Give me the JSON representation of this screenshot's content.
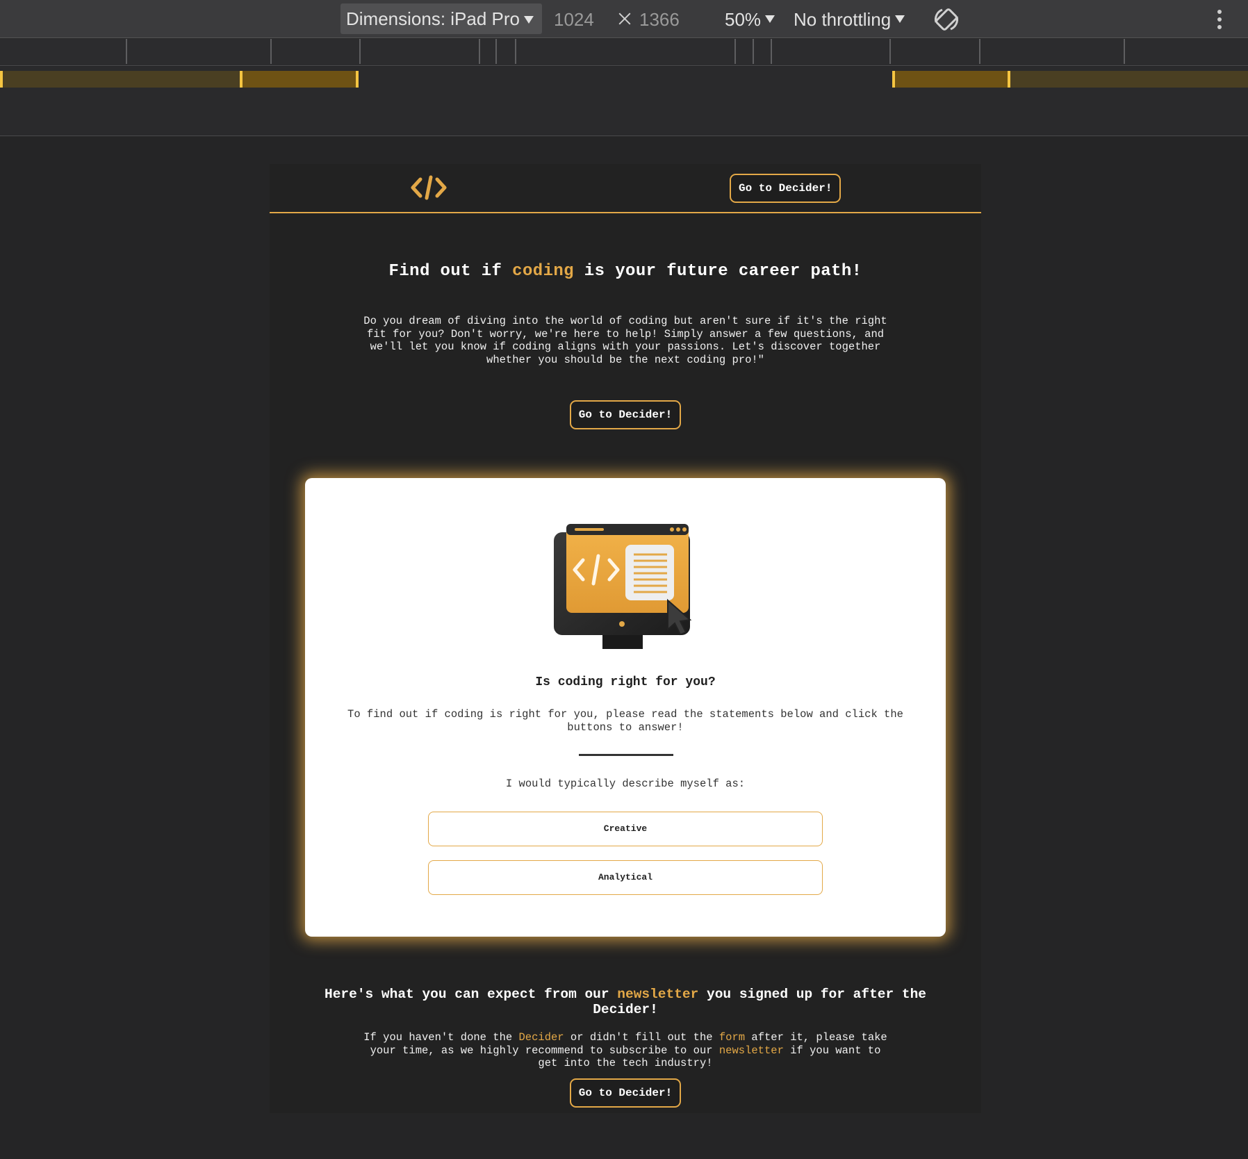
{
  "devtools": {
    "device_label": "Dimensions: iPad Pro",
    "width_value": "1024",
    "height_value": "1366",
    "zoom_label": "50%",
    "throttling_label": "No throttling",
    "icons": [
      "caret-down-icon",
      "rotate-icon",
      "more-vert-icon"
    ]
  },
  "site": {
    "logo_icon": "code-brackets-icon",
    "header_button": "Go to Decider!",
    "hero": {
      "title_before": "Find out if ",
      "title_accent": "coding",
      "title_after": " is your future career path!",
      "paragraph": "Do you dream of diving into the world of coding but aren't sure if it's the right fit for you? Don't worry, we're here to help! Simply answer a few questions, and we'll let you know if coding aligns with your passions. Let's discover together whether you should be the next coding pro!\"",
      "button": "Go to Decider!"
    },
    "quiz_card": {
      "illustration_icon": "monitor-code-icon",
      "title": "Is coding right for you?",
      "intro": "To find out if coding is right for you, please read the statements below and click the buttons to answer!",
      "question": "I would typically describe myself as:",
      "answers": [
        "Creative",
        "Analytical"
      ]
    },
    "newsletter": {
      "title_before": "Here's what you can expect from our ",
      "title_accent": "newsletter",
      "title_after": " you signed up for after the Decider!",
      "text_1": "If you haven't done the ",
      "text_link_1": "Decider",
      "text_2": " or didn't fill out the ",
      "text_link_2": "form",
      "text_3": " after it, please take your time, as we highly recommend to subscribe to our ",
      "text_link_3": "newsletter",
      "text_4": " if you want to get into the tech industry!",
      "button": "Go to Decider!"
    },
    "colors": {
      "accent": "#e3a847",
      "background": "#222222",
      "card": "#ffffff"
    }
  }
}
